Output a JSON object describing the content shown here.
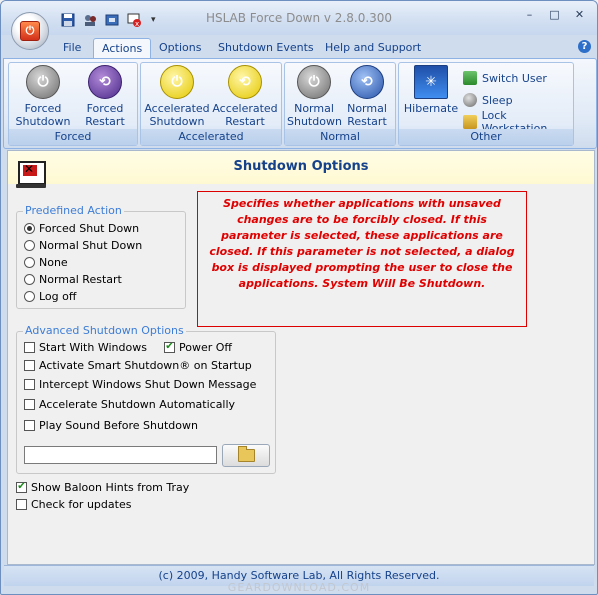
{
  "window": {
    "title": "HSLAB Force Down v 2.8.0.300",
    "controls": {
      "minimize": "–",
      "maximize": "□",
      "close": "✕"
    }
  },
  "quick_access": {
    "icons": [
      "save-icon",
      "users-icon",
      "settings-icon",
      "shutdown-icon"
    ],
    "customize_label": "▾"
  },
  "tabs": [
    {
      "label": "File",
      "active": false
    },
    {
      "label": "Actions",
      "active": true
    },
    {
      "label": "Options",
      "active": false
    },
    {
      "label": "Shutdown Events",
      "active": false
    },
    {
      "label": "Help and Support",
      "active": false
    }
  ],
  "help_label": "?",
  "ribbon": {
    "groups": [
      {
        "label": "Forced",
        "buttons": [
          {
            "line1": "Forced",
            "line2": "Shutdown",
            "icon": "power-icon"
          },
          {
            "line1": "Forced",
            "line2": "Restart",
            "icon": "restart-icon"
          }
        ]
      },
      {
        "label": "Accelerated",
        "buttons": [
          {
            "line1": "Accelerated",
            "line2": "Shutdown",
            "icon": "power-icon"
          },
          {
            "line1": "Accelerated",
            "line2": "Restart",
            "icon": "restart-icon"
          }
        ]
      },
      {
        "label": "Normal",
        "buttons": [
          {
            "line1": "Normal",
            "line2": "Shutdown",
            "icon": "power-icon"
          },
          {
            "line1": "Normal",
            "line2": "Restart",
            "icon": "restart-icon"
          }
        ]
      },
      {
        "label": "Other",
        "buttons": [
          {
            "label": "Hibernate",
            "icon": "hibernate-icon"
          },
          {
            "label": "Switch User",
            "icon": "switch-user-icon"
          },
          {
            "label": "Sleep",
            "icon": "sleep-icon"
          },
          {
            "label": "Lock Workstation",
            "icon": "lock-icon"
          }
        ]
      }
    ]
  },
  "panel": {
    "title": "Shutdown Options",
    "predefined_action": {
      "legend": "Predefined  Action",
      "options": [
        {
          "label": "Forced Shut Down",
          "selected": true
        },
        {
          "label": "Normal Shut Down",
          "selected": false
        },
        {
          "label": "None",
          "selected": false
        },
        {
          "label": "Normal Restart",
          "selected": false
        },
        {
          "label": "Log off",
          "selected": false
        }
      ]
    },
    "description": "Specifies whether applications with unsaved changes are to be forcibly closed. If this parameter is selected, these applications are closed. If this parameter is not selected, a dialog box is displayed prompting the user to close the applications. System Will Be Shutdown.",
    "advanced": {
      "legend": "Advanced Shutdown Options",
      "start_with_windows": {
        "label": "Start With Windows",
        "checked": false
      },
      "power_off": {
        "label": "Power Off",
        "checked": true
      },
      "smart_shutdown": {
        "label": "Activate Smart Shutdown® on Startup",
        "checked": false
      },
      "intercept": {
        "label": "Intercept Windows Shut Down Message",
        "checked": false
      },
      "accelerate": {
        "label": "Accelerate Shutdown Automatically",
        "checked": false
      },
      "play_sound": {
        "label": "Play Sound Before Shutdown",
        "checked": false
      },
      "sound_path": "",
      "browse_icon": "folder-icon"
    },
    "show_hints": {
      "label": "Show Baloon Hints from Tray",
      "checked": true
    },
    "check_updates": {
      "label": "Check for updates",
      "checked": false
    }
  },
  "status": "(c) 2009, Handy Software Lab, All Rights Reserved.",
  "watermark": "GEARDOWNLOAD.COM",
  "colors": {
    "accent": "#15428b",
    "description_text": "#e00000",
    "legend": "#3d7dd6"
  }
}
